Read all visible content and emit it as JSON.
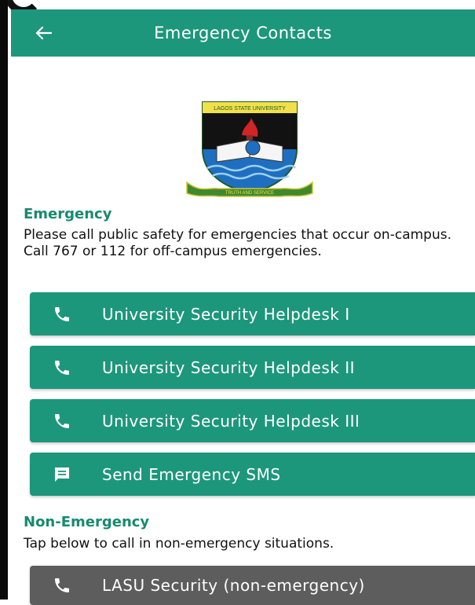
{
  "header": {
    "title": "Emergency Contacts",
    "back_icon": "arrow-left-icon"
  },
  "logo": {
    "top_text": "LAGOS STATE UNIVERSITY",
    "motto": "TRUTH AND SERVICE"
  },
  "emergency": {
    "title": "Emergency",
    "description": "Please call public safety for emergencies that occur on-campus. Call 767 or 112 for off-campus emergencies.",
    "buttons": [
      {
        "label": "University Security Helpdesk I",
        "icon": "phone-icon"
      },
      {
        "label": "University Security Helpdesk II",
        "icon": "phone-icon"
      },
      {
        "label": "University Security Helpdesk III",
        "icon": "phone-icon"
      },
      {
        "label": "Send Emergency SMS",
        "icon": "message-icon"
      }
    ]
  },
  "non_emergency": {
    "title": "Non-Emergency",
    "description": "Tap below to call in non-emergency situations.",
    "buttons": [
      {
        "label": "LASU Security (non-emergency)",
        "icon": "phone-icon"
      }
    ]
  },
  "colors": {
    "primary": "#1d977b",
    "section_title": "#178a6f",
    "secondary_button": "#5d5d5d"
  }
}
